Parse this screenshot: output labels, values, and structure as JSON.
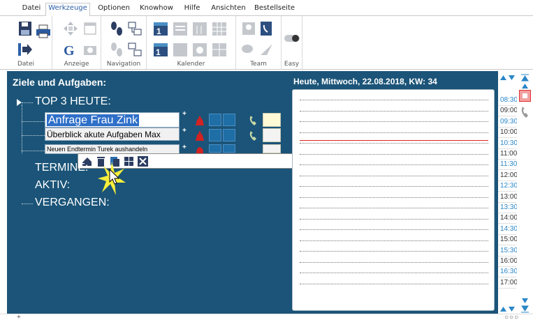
{
  "menu": {
    "tabs": [
      {
        "label": "Datei",
        "active": false
      },
      {
        "label": "Werkzeuge",
        "active": true
      },
      {
        "label": "Optionen",
        "active": false
      },
      {
        "label": "Knowhow",
        "active": false
      },
      {
        "label": "Hilfe",
        "active": false
      },
      {
        "label": "Ansichten",
        "active": false
      },
      {
        "label": "Bestellseite",
        "active": false
      }
    ]
  },
  "ribbon": {
    "groups": [
      {
        "label": "Datei"
      },
      {
        "label": "Anzeige"
      },
      {
        "label": "Navigation"
      },
      {
        "label": "Kalender"
      },
      {
        "label": "Team"
      },
      {
        "label": "Easy"
      }
    ]
  },
  "goals": {
    "title": "Ziele und Aufgaben:",
    "top3": "TOP 3 HEUTE:",
    "tasks": [
      {
        "text": "Anfrage Frau Zink"
      },
      {
        "text": "Überblick akute Aufgaben Max"
      },
      {
        "text": "Neuen Endtermin Turek aushandeln"
      }
    ],
    "termine": "TERMINE:",
    "aktiv": "AKTIV:",
    "vergangen": "VERGANGEN:",
    "plus": "+"
  },
  "day": {
    "header": "Heute, Mittwoch, 22.08.2018, KW: 34"
  },
  "times": [
    {
      "label": "08:30",
      "half": true
    },
    {
      "label": "09:00",
      "half": false
    },
    {
      "label": "09:30",
      "half": true
    },
    {
      "label": "10:00",
      "half": false
    },
    {
      "label": "10:30",
      "half": true
    },
    {
      "label": "11:00",
      "half": false
    },
    {
      "label": "11:30",
      "half": true
    },
    {
      "label": "12:00",
      "half": false
    },
    {
      "label": "12:30",
      "half": true
    },
    {
      "label": "13:00",
      "half": false
    },
    {
      "label": "13:30",
      "half": true
    },
    {
      "label": "14:00",
      "half": false
    },
    {
      "label": "14:30",
      "half": true
    },
    {
      "label": "15:00",
      "half": false
    },
    {
      "label": "15:30",
      "half": true
    },
    {
      "label": "16:00",
      "half": false
    },
    {
      "label": "16:30",
      "half": true
    },
    {
      "label": "17:00",
      "half": false
    }
  ],
  "bottom": {
    "plus": "+",
    "dots": "○○○"
  },
  "colors": {
    "panel_bg": "#1b5478",
    "half_hour": "#2a86c7",
    "full_hour": "#333333",
    "now_line": "#dd2222",
    "accent_tab": "#2b5fa8"
  },
  "icons": {
    "bell": "alarm-bell-icon",
    "phone": "phone-icon",
    "popup": [
      "move-up-icon",
      "delete-icon",
      "copy-icon",
      "grid-icon",
      "close-icon"
    ]
  }
}
